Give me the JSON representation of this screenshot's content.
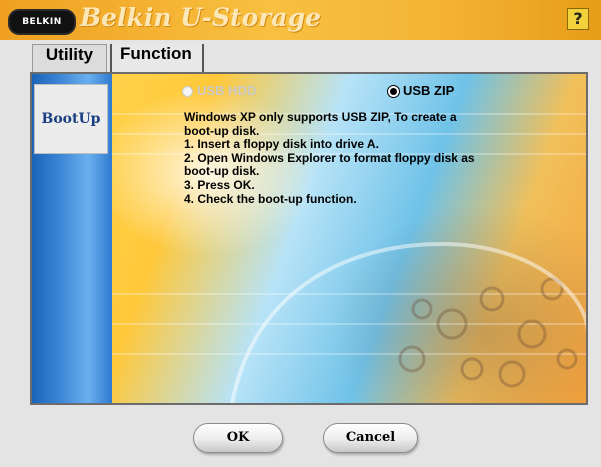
{
  "titlebar": {
    "logo_text": "BELKIN",
    "title": "Belkin U-Storage",
    "help_label": "?"
  },
  "tabs": [
    {
      "label": "Utility",
      "active": true
    },
    {
      "label": "Function",
      "active": false
    }
  ],
  "sidebar": {
    "items": [
      {
        "label": "BootUp",
        "selected": true
      }
    ]
  },
  "options": {
    "usb_hdd": {
      "label": "USB HDD",
      "enabled": false,
      "selected": false
    },
    "usb_zip": {
      "label": "USB ZIP",
      "enabled": true,
      "selected": true
    }
  },
  "instructions": [
    "Windows XP only supports USB ZIP, To create a",
    "boot-up disk.",
    "1. Insert a floppy disk into drive A.",
    "2. Open Windows Explorer to format floppy disk as",
    "boot-up disk.",
    "3. Press OK.",
    "4. Check the boot-up function."
  ],
  "buttons": {
    "ok": "OK",
    "cancel": "Cancel"
  },
  "colors": {
    "titlebar": "#f3b232",
    "sidebar": "#3d86d6",
    "disabled_text": "#c9c9c9"
  }
}
